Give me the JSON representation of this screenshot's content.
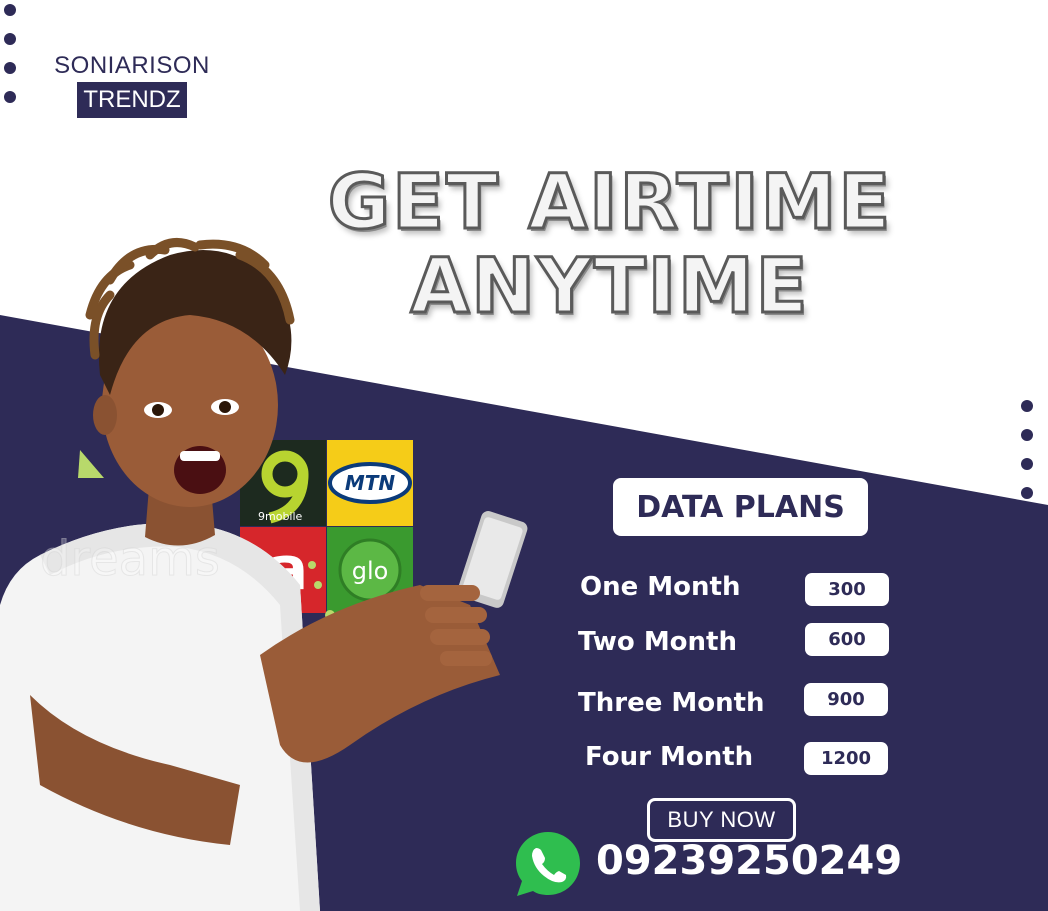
{
  "brand": {
    "line1": "SONIARISON",
    "line2": "TRENDZ"
  },
  "headline": {
    "line1": "GET AIRTIME",
    "line2": "ANYTIME"
  },
  "network_logos": {
    "nine_mobile": "9mobile",
    "mtn": "MTN",
    "airtel": "a",
    "glo": "glo"
  },
  "data_plans": {
    "title": "DATA PLANS",
    "plans": [
      {
        "label": "One Month",
        "price": "300"
      },
      {
        "label": "Two Month",
        "price": "600"
      },
      {
        "label": "Three Month",
        "price": "900"
      },
      {
        "label": "Four Month",
        "price": "1200"
      }
    ]
  },
  "cta": {
    "buy_label": "BUY NOW"
  },
  "contact": {
    "phone": "09239250249",
    "icon": "whatsapp-icon"
  },
  "watermark": "dreams",
  "colors": {
    "navy": "#2e2b57",
    "white": "#ffffff",
    "mtn_yellow": "#f5cc18",
    "glo_green": "#3a9a2f",
    "airtel_red": "#d6262b",
    "accent_green": "#b8d96b"
  }
}
